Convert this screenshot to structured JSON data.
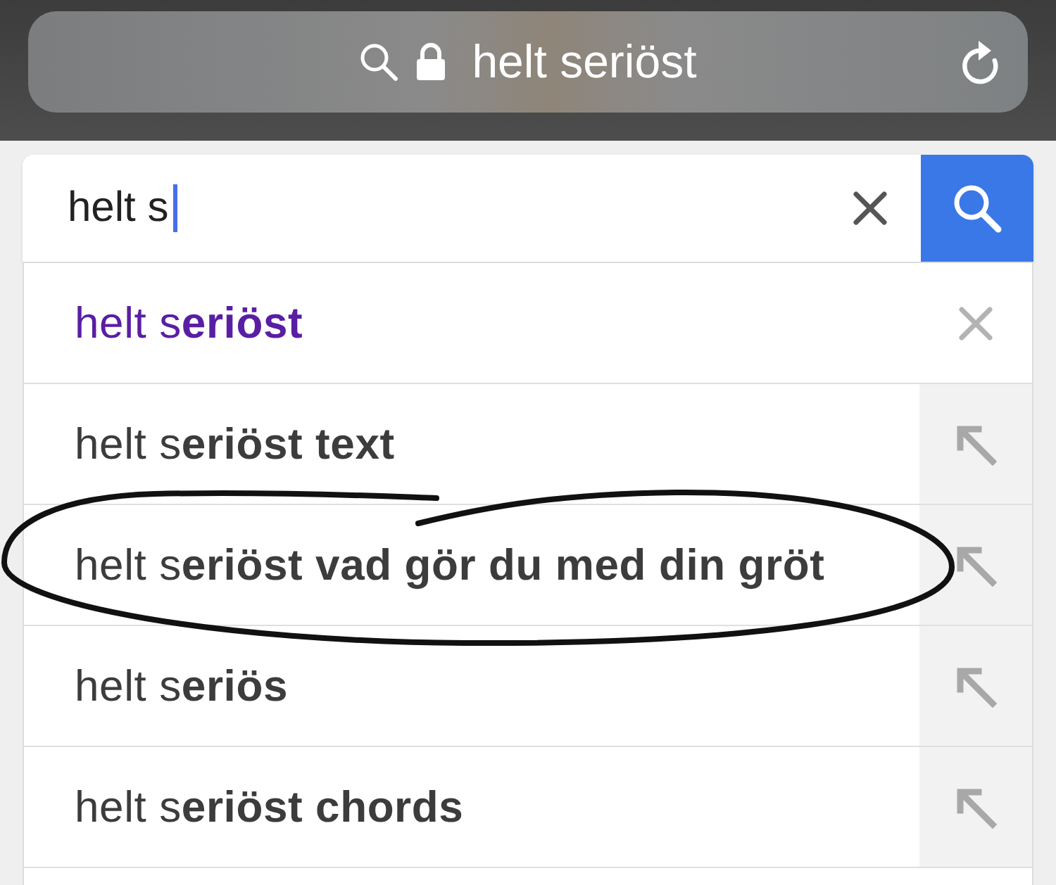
{
  "address_bar": {
    "text": "helt seriöst"
  },
  "search": {
    "value": "helt s",
    "focused": true
  },
  "suggestions": [
    {
      "text": "helt s**eriöst**",
      "kind": "history",
      "circled": false
    },
    {
      "text": "helt s**eriöst text**",
      "kind": "query",
      "circled": false
    },
    {
      "text": "helt s**eriöst vad gör du med din gröt**",
      "kind": "query",
      "circled": true
    },
    {
      "text": "helt s**eriös**",
      "kind": "query",
      "circled": false
    },
    {
      "text": "helt s**eriöst chords**",
      "kind": "query",
      "circled": false
    }
  ]
}
